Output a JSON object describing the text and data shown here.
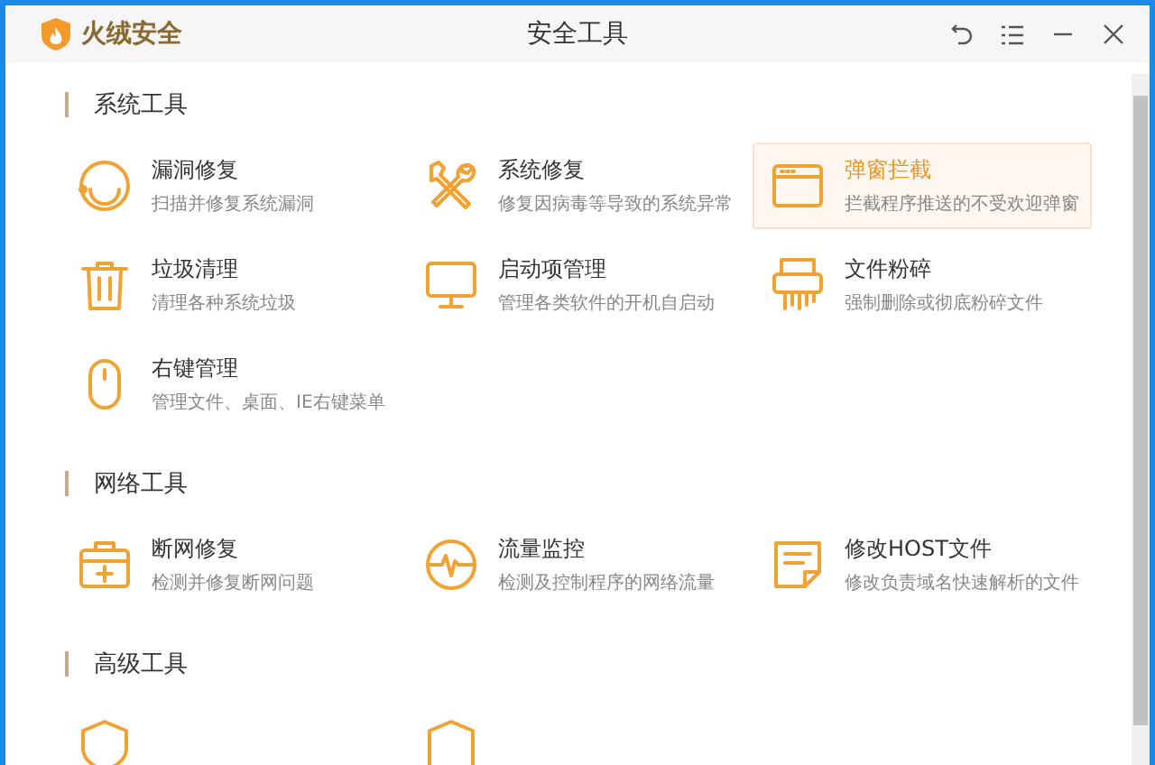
{
  "window": {
    "brand": "火绒安全",
    "title": "安全工具"
  },
  "sections": [
    {
      "title": "系统工具",
      "items": [
        {
          "name": "漏洞修复",
          "description": "扫描并修复系统漏洞",
          "selected": false
        },
        {
          "name": "系统修复",
          "description": "修复因病毒等导致的系统异常",
          "selected": false
        },
        {
          "name": "弹窗拦截",
          "description": "拦截程序推送的不受欢迎弹窗",
          "selected": true
        },
        {
          "name": "垃圾清理",
          "description": "清理各种系统垃圾",
          "selected": false
        },
        {
          "name": "启动项管理",
          "description": "管理各类软件的开机自启动",
          "selected": false
        },
        {
          "name": "文件粉碎",
          "description": "强制删除或彻底粉碎文件",
          "selected": false
        },
        {
          "name": "右键管理",
          "description": "管理文件、桌面、IE右键菜单",
          "selected": false
        }
      ]
    },
    {
      "title": "网络工具",
      "items": [
        {
          "name": "断网修复",
          "description": "检测并修复断网问题",
          "selected": false
        },
        {
          "name": "流量监控",
          "description": "检测及控制程序的网络流量",
          "selected": false
        },
        {
          "name": "修改HOST文件",
          "description": "修改负责域名快速解析的文件",
          "selected": false
        }
      ]
    },
    {
      "title": "高级工具",
      "items": [
        {
          "selected": false
        },
        {
          "selected": false
        }
      ]
    }
  ]
}
